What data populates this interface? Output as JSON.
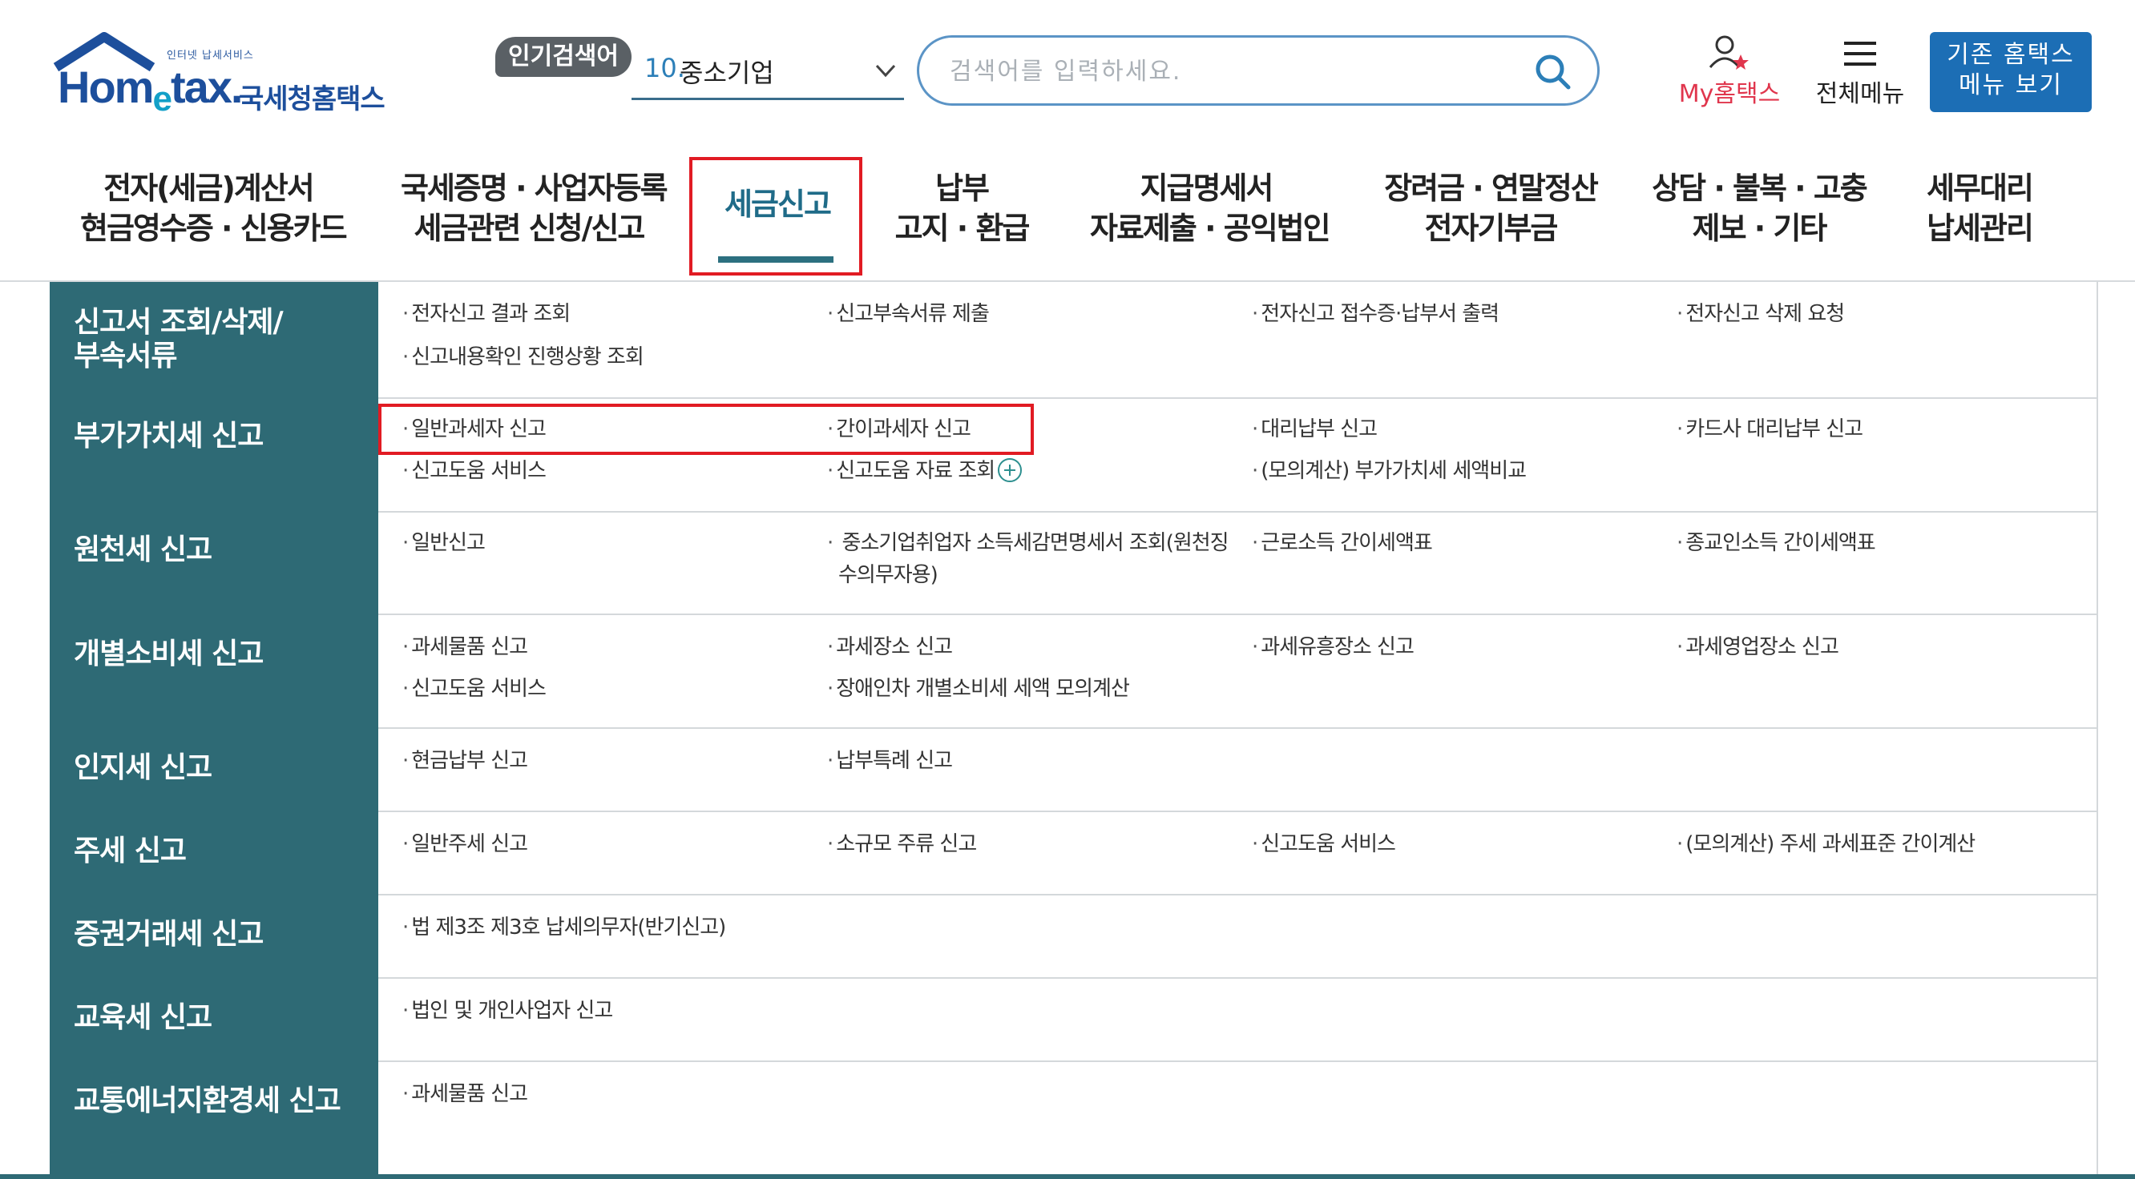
{
  "logo": {
    "tagline": "인터넷 납세서비스",
    "brand_pre": "Hom",
    "brand_e": "e",
    "brand_post": "tax.",
    "name": "국세청홈택스"
  },
  "popular": {
    "badge": "인기검색어",
    "rank": "10.",
    "keyword": "중소기업"
  },
  "search": {
    "placeholder": "검색어를 입력하세요."
  },
  "utility": {
    "my_home": "My홈택스",
    "all_menu": "전체메뉴",
    "old_home_line1": "기존 홈택스",
    "old_home_line2": "메뉴 보기"
  },
  "gnb": [
    {
      "l1": "전자(세금)계산서",
      "l2": "현금영수증 · 신용카드"
    },
    {
      "l1": "국세증명 · 사업자등록",
      "l2": "세금관련 신청/신고"
    },
    {
      "l1": "세금신고",
      "l2": ""
    },
    {
      "l1": "납부",
      "l2": "고지 · 환급"
    },
    {
      "l1": "지급명세서",
      "l2": "자료제출 · 공익법인"
    },
    {
      "l1": "장려금 · 연말정산",
      "l2": "전자기부금"
    },
    {
      "l1": "상담 · 불복 · 고충",
      "l2": "제보 · 기타"
    },
    {
      "l1": "세무대리",
      "l2": "납세관리"
    }
  ],
  "categories": [
    {
      "title_l1": "신고서 조회/삭제/",
      "title_l2": "부속서류",
      "items": [
        "전자신고 결과 조회",
        "신고부속서류 제출",
        "전자신고 접수증·납부서 출력",
        "전자신고 삭제 요청",
        "신고내용확인 진행상황 조회"
      ]
    },
    {
      "title_l1": "부가가치세 신고",
      "title_l2": "",
      "items": [
        "일반과세자 신고",
        "간이과세자 신고",
        "대리납부 신고",
        "카드사 대리납부 신고",
        "신고도움 서비스",
        "신고도움 자료 조회",
        "(모의계산) 부가가치세 세액비교"
      ]
    },
    {
      "title_l1": "원천세 신고",
      "title_l2": "",
      "items": [
        "일반신고",
        "중소기업취업자 소득세감면명세서 조회(원천징",
        "수의무자용)",
        "근로소득 간이세액표",
        "종교인소득 간이세액표"
      ]
    },
    {
      "title_l1": "개별소비세 신고",
      "title_l2": "",
      "items": [
        "과세물품 신고",
        "과세장소 신고",
        "과세유흥장소 신고",
        "과세영업장소 신고",
        "신고도움 서비스",
        "장애인차 개별소비세 세액 모의계산"
      ]
    },
    {
      "title_l1": "인지세 신고",
      "title_l2": "",
      "items": [
        "현금납부 신고",
        "납부특례 신고"
      ]
    },
    {
      "title_l1": "주세 신고",
      "title_l2": "",
      "items": [
        "일반주세 신고",
        "소규모 주류 신고",
        "신고도움 서비스",
        "(모의계산) 주세 과세표준 간이계산"
      ]
    },
    {
      "title_l1": "증권거래세 신고",
      "title_l2": "",
      "items": [
        "법 제3조 제3호 납세의무자(반기신고)"
      ]
    },
    {
      "title_l1": "교육세 신고",
      "title_l2": "",
      "items": [
        "법인 및 개인사업자 신고"
      ]
    },
    {
      "title_l1": "교통에너지환경세 신고",
      "title_l2": "",
      "items": [
        "과세물품 신고"
      ]
    }
  ],
  "colors": {
    "category_bg": "#2e6a75",
    "highlight": "#e11b23",
    "brand_blue": "#1d4f9c",
    "button_blue": "#1c6eb5",
    "my_red": "#e0364d"
  }
}
